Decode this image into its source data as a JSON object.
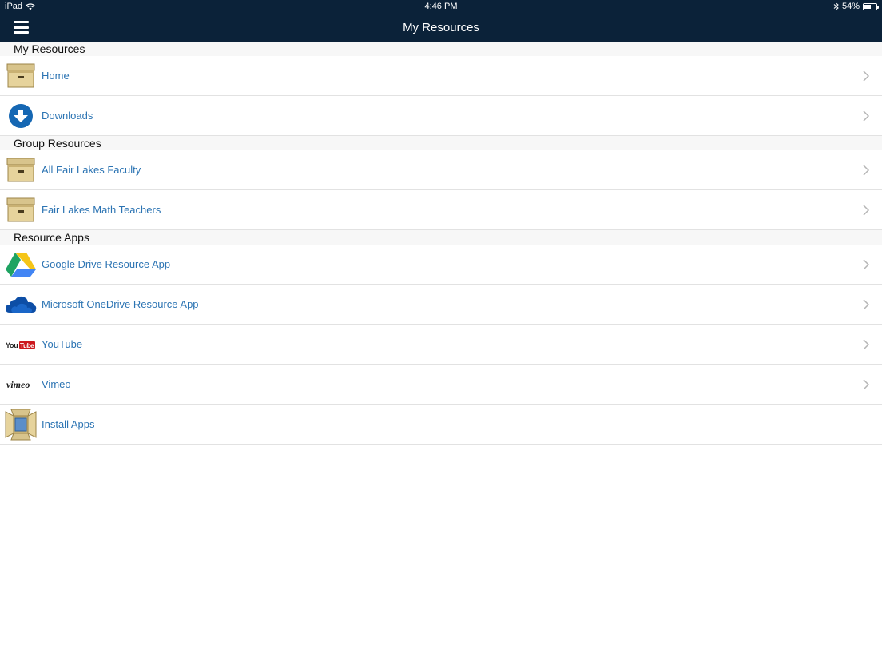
{
  "status_bar": {
    "device": "iPad",
    "time": "4:46 PM",
    "battery": "54%",
    "battery_level": 0.54
  },
  "nav": {
    "title": "My Resources",
    "menu_icon": "hamburger-icon"
  },
  "sections": [
    {
      "header": "My Resources",
      "items": [
        {
          "label": "Home",
          "icon": "archive-box-icon",
          "chevron": true
        },
        {
          "label": "Downloads",
          "icon": "download-circle-icon",
          "chevron": true
        }
      ]
    },
    {
      "header": "Group Resources",
      "items": [
        {
          "label": "All Fair Lakes Faculty",
          "icon": "archive-box-icon",
          "chevron": true
        },
        {
          "label": "Fair Lakes Math Teachers",
          "icon": "archive-box-icon",
          "chevron": true
        }
      ]
    },
    {
      "header": "Resource Apps",
      "items": [
        {
          "label": "Google Drive Resource App",
          "icon": "google-drive-icon",
          "chevron": true
        },
        {
          "label": "Microsoft OneDrive Resource App",
          "icon": "onedrive-icon",
          "chevron": true
        },
        {
          "label": "YouTube",
          "icon": "youtube-logo",
          "chevron": true,
          "logo_text": "YouTube"
        },
        {
          "label": "Vimeo",
          "icon": "vimeo-logo",
          "chevron": true,
          "logo_text": "vimeo"
        },
        {
          "label": "Install Apps",
          "icon": "install-apps-icon",
          "chevron": false
        }
      ]
    }
  ],
  "colors": {
    "nav_background": "#0b2239",
    "link_blue": "#2c74b3",
    "section_background": "#f7f7f7"
  }
}
